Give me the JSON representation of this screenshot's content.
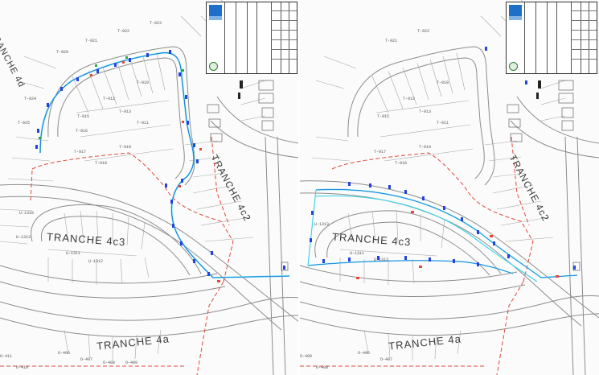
{
  "left_sheet": {
    "tranche_labels": [
      "TRANCHE 4d",
      "TRANCHE 4c3",
      "TRANCHE 4c2",
      "TRANCHE 4a"
    ],
    "lot_labels": [
      "T-920",
      "T-921",
      "T-922",
      "T-923",
      "T-924",
      "T-925",
      "T-917",
      "T-918",
      "T-919",
      "T-912",
      "T-913",
      "T-915",
      "T-916",
      "T-910",
      "T-911",
      "U-1311",
      "U-1312",
      "U-1313",
      "U-1310",
      "O-406",
      "O-407",
      "O-408",
      "O-409",
      "O-410",
      "O-411"
    ]
  },
  "right_sheet": {
    "tranche_labels": [
      "TRANCHE 4c3",
      "TRANCHE 4c2",
      "TRANCHE 4a"
    ],
    "lot_labels": [
      "T-921",
      "T-922",
      "T-917",
      "T-918",
      "T-919",
      "T-912",
      "T-913",
      "T-915",
      "T-910",
      "T-911",
      "U-1311",
      "U-1312",
      "U-1313",
      "O-406",
      "O-407",
      "O-408",
      "O-409"
    ]
  },
  "colors": {
    "redline": "#e0483a",
    "cyan": "#3fd6e8",
    "blue": "#2244dd",
    "lotline": "#9a9a9a"
  }
}
